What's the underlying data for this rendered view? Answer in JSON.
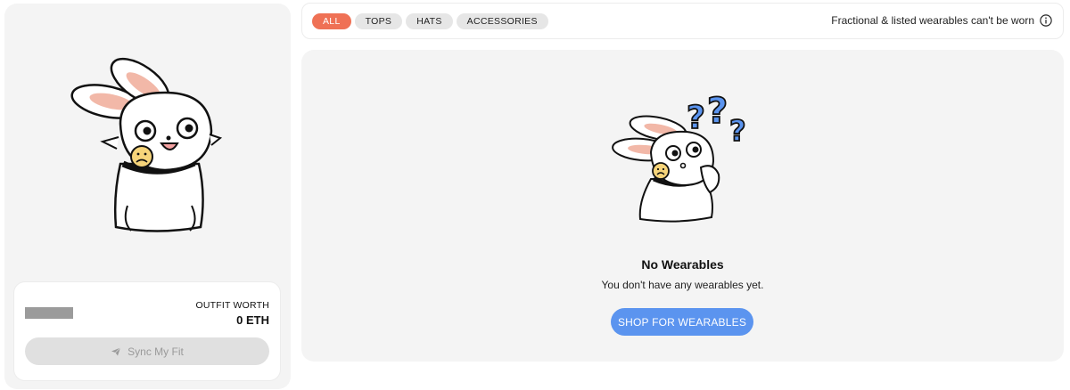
{
  "filters": {
    "items": [
      {
        "label": "ALL",
        "active": true
      },
      {
        "label": "TOPS",
        "active": false
      },
      {
        "label": "HATS",
        "active": false
      },
      {
        "label": "ACCESSORIES",
        "active": false
      }
    ],
    "notice": "Fractional & listed wearables can't be worn",
    "notice_icon": "info-icon"
  },
  "outfit": {
    "worth_label": "OUTFIT WORTH",
    "worth_value": "0 ETH",
    "sync_label": "Sync My Fit",
    "sync_icon": "paper-plane-icon"
  },
  "empty_state": {
    "title": "No Wearables",
    "subtitle": "You don't have any wearables yet.",
    "button_label": "SHOP FOR WEARABLES"
  },
  "colors": {
    "accent_active": "#ef7155",
    "primary_button": "#5b94ef",
    "question_marks": "#5b94ef",
    "panel_bg": "#f4f4f4"
  }
}
